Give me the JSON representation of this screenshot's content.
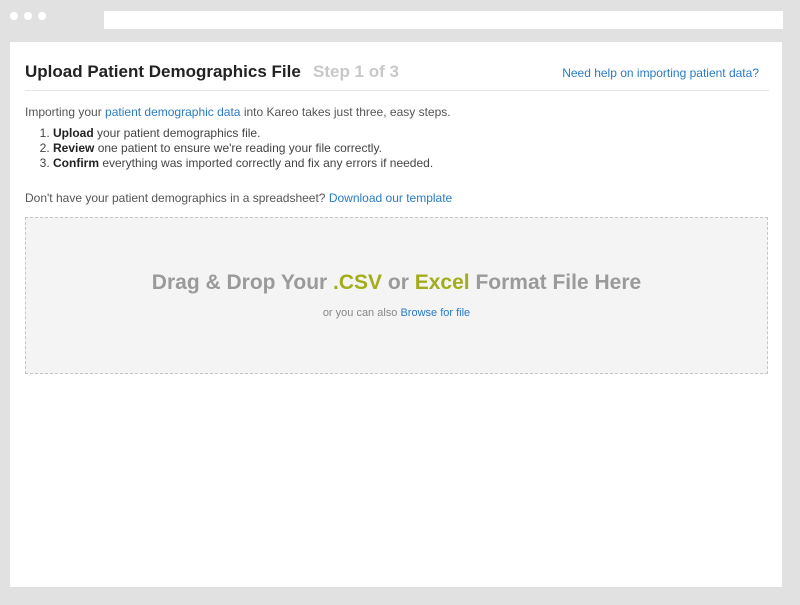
{
  "header": {
    "title": "Upload Patient Demographics File",
    "step": "Step 1 of 3",
    "help_link": "Need help on importing patient data?"
  },
  "intro": {
    "prefix": "Importing your ",
    "link": "patient demographic data",
    "suffix": " into Kareo takes just three, easy steps."
  },
  "steps": [
    {
      "bold": "Upload",
      "text": " your patient demographics file."
    },
    {
      "bold": "Review",
      "text": " one patient to ensure we're reading your file correctly."
    },
    {
      "bold": "Confirm",
      "text": " everything was imported correctly and fix any errors if needed."
    }
  ],
  "template": {
    "text": "Don't have your patient demographics in a spreadsheet? ",
    "link": "Download our template"
  },
  "dropzone": {
    "heading_prefix": "Drag & Drop Your ",
    "csv": ".CSV",
    "or": " or ",
    "excel": "Excel",
    "heading_suffix": " Format File Here",
    "sub_text": "or you can also ",
    "browse_link": "Browse for file"
  },
  "colors": {
    "link": "#2a7bc4",
    "accent": "#a3ad1c",
    "muted_heading": "#9a9a9a"
  }
}
